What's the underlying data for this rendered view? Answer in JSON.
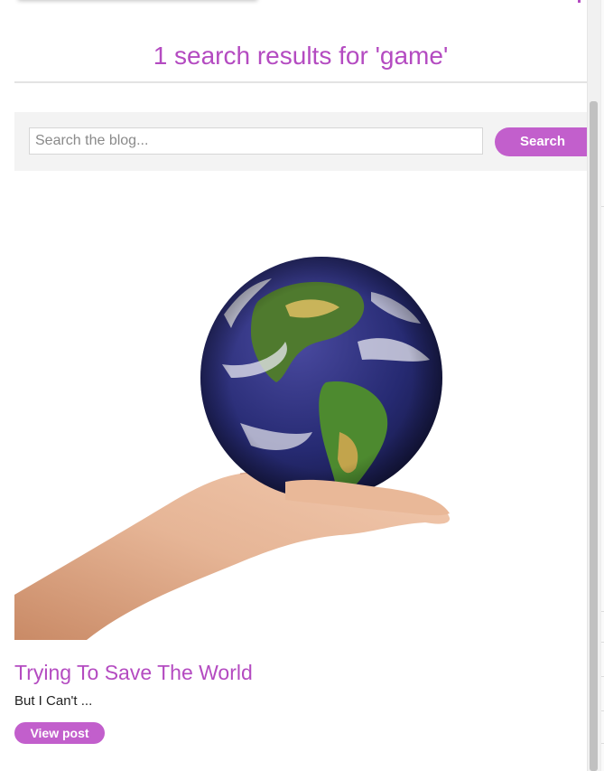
{
  "results": {
    "heading": "1 search results for 'game'"
  },
  "search": {
    "placeholder": "Search the blog...",
    "value": "",
    "button_label": "Search"
  },
  "post": {
    "title": "Trying To Save The World",
    "excerpt": "But I Can't ...",
    "cta_label": "View post",
    "image_alt": "Hand holding globe"
  },
  "colors": {
    "accent": "#b44bc1",
    "button": "#c25fcc",
    "panel": "#f3f3f3"
  }
}
